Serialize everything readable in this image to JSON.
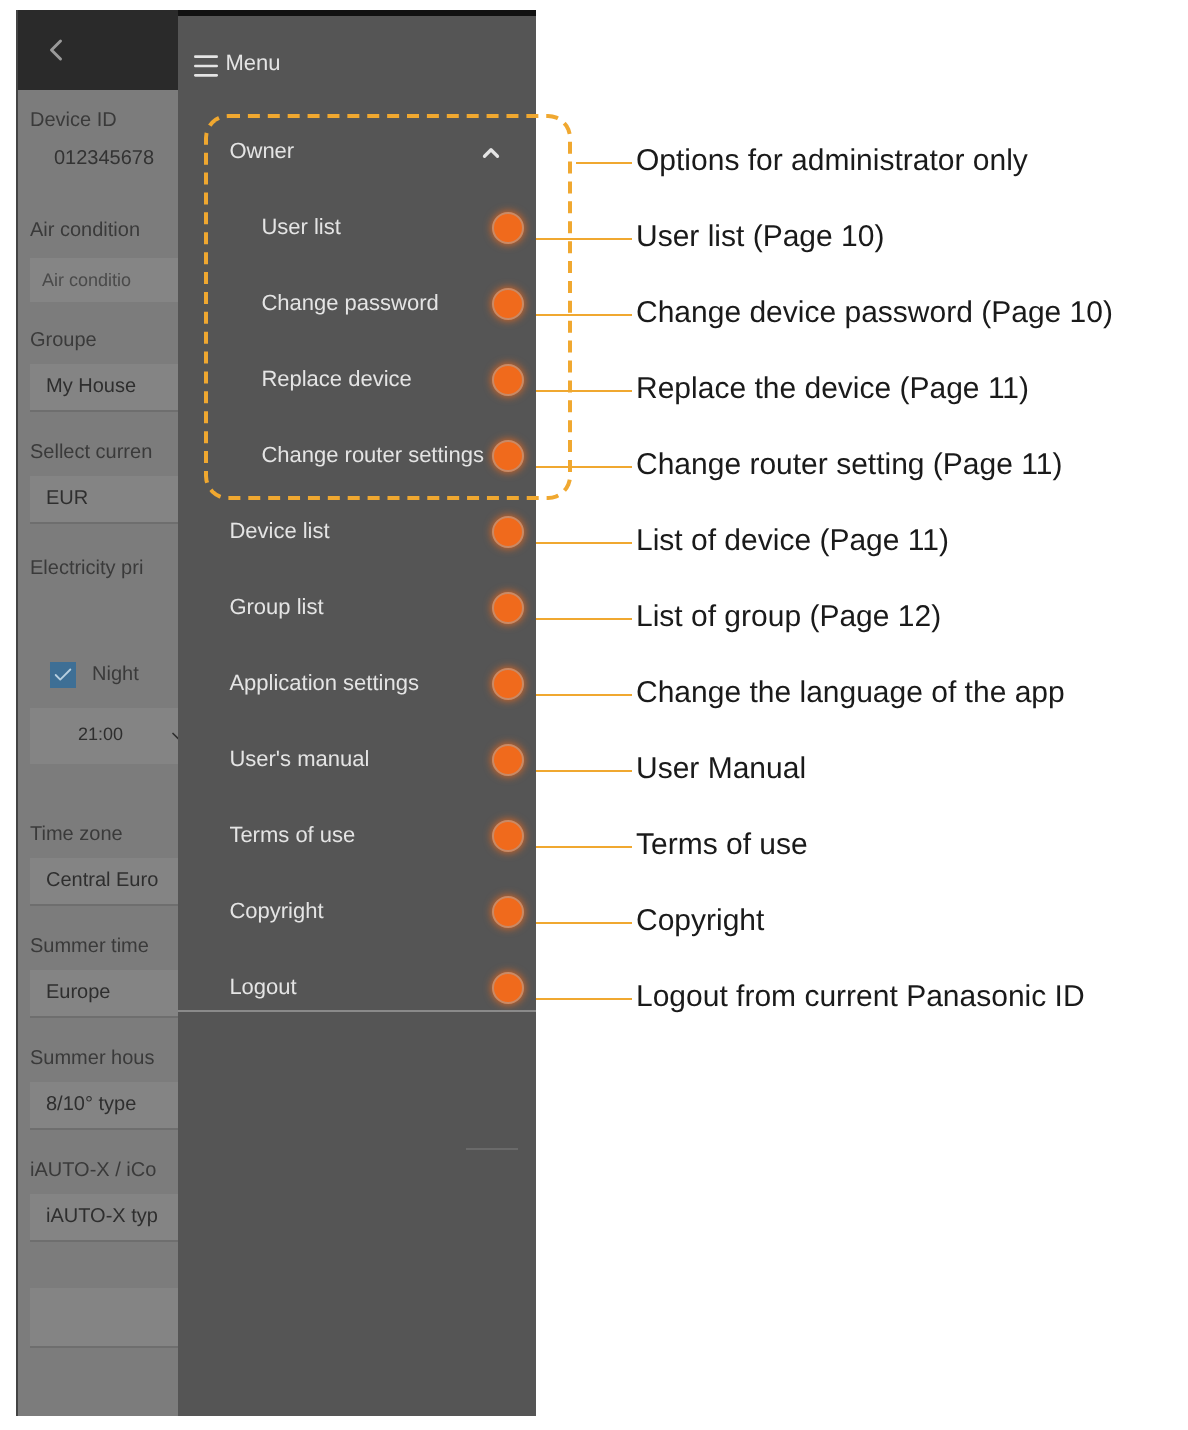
{
  "background_form": [
    {
      "kind": "value",
      "label": "Device ID",
      "value": "012345678"
    },
    {
      "kind": "input",
      "label": "Air condition",
      "placeholder": "Air conditio"
    },
    {
      "kind": "select",
      "label": "Groupe",
      "value": "My House"
    },
    {
      "kind": "select",
      "label": "Sellect curren",
      "value": "EUR"
    },
    {
      "kind": "section",
      "label": "Electricity pri"
    },
    {
      "kind": "checkbox",
      "label": "Night",
      "checked": true
    },
    {
      "kind": "time",
      "value": "21:00"
    },
    {
      "kind": "select",
      "label": "Time zone",
      "value": "Central Euro"
    },
    {
      "kind": "select",
      "label": "Summer time",
      "value": "Europe"
    },
    {
      "kind": "select",
      "label": "Summer hous",
      "value": "8/10° type"
    },
    {
      "kind": "select",
      "label": "iAUTO-X / iCo",
      "value": "iAUTO-X typ"
    },
    {
      "kind": "button"
    }
  ],
  "menu": {
    "title": "Menu",
    "items": [
      {
        "label": "Owner",
        "expanded": true,
        "children": [
          {
            "label": "User list"
          },
          {
            "label": "Change password"
          },
          {
            "label": "Replace device"
          },
          {
            "label": "Change router settings"
          }
        ]
      },
      {
        "label": "Device list"
      },
      {
        "label": "Group list"
      },
      {
        "label": "Application settings"
      },
      {
        "label": "User's manual"
      },
      {
        "label": "Terms of use"
      },
      {
        "label": "Copyright"
      },
      {
        "label": "Logout"
      }
    ]
  },
  "callouts": [
    "Options for administrator only",
    "User list (Page 10)",
    "Change device password (Page 10)",
    "Replace the device (Page 11)",
    "Change router setting (Page 11)",
    "List of device (Page 11)",
    "List of group (Page 12)",
    "Change the language of the app",
    "User Manual",
    "Terms of use",
    "Copyright",
    "Logout from current Panasonic ID"
  ]
}
